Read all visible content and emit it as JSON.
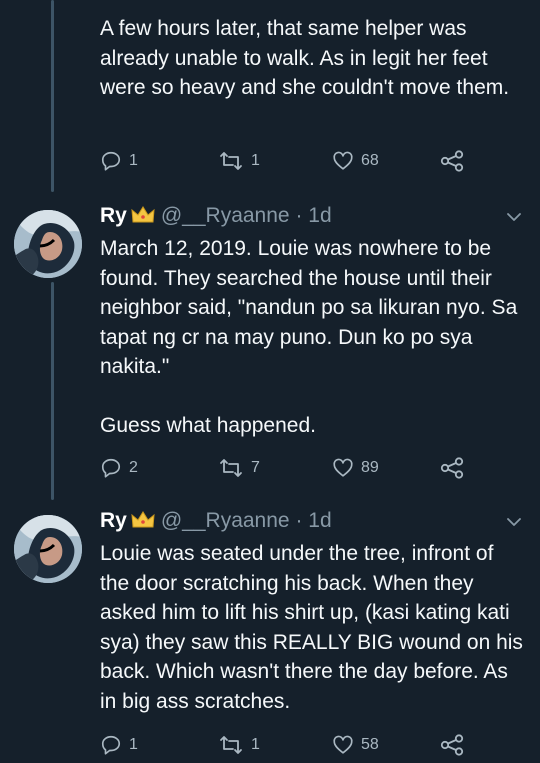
{
  "tweets": [
    {
      "has_header": false,
      "text": "A few hours later, that same helper was already unable to walk. As in legit her feet were so heavy and she couldn't move them.",
      "actions": {
        "replies": "1",
        "retweets": "1",
        "likes": "68"
      }
    },
    {
      "has_header": true,
      "name": "Ry",
      "handle": "@__Ryaanne",
      "time": "· 1d",
      "text": "March 12, 2019. Louie was nowhere to be found. They searched the house until their neighbor said, \"nandun po sa likuran nyo. Sa tapat ng cr na may puno. Dun ko po sya nakita.\"\n\nGuess what happened.",
      "actions": {
        "replies": "2",
        "retweets": "7",
        "likes": "89"
      }
    },
    {
      "has_header": true,
      "name": "Ry",
      "handle": "@__Ryaanne",
      "time": "· 1d",
      "text": "Louie was seated under the tree, infront of the door scratching his back. When they asked him to lift his shirt up, (kasi kating kati sya) they saw this REALLY BIG wound on his back. Which wasn't there the day before. As in big ass scratches.",
      "actions": {
        "replies": "1",
        "retweets": "1",
        "likes": "58"
      }
    }
  ],
  "icons": {
    "reply": "reply-icon",
    "retweet": "retweet-icon",
    "like": "heart-icon",
    "share": "share-icon",
    "more": "chevron-down-icon",
    "crown": "crown-emoji-icon"
  },
  "colors": {
    "background": "#15202b",
    "text": "#f5f8fa",
    "secondary": "#8899a6",
    "thread_line": "#3d5466"
  }
}
